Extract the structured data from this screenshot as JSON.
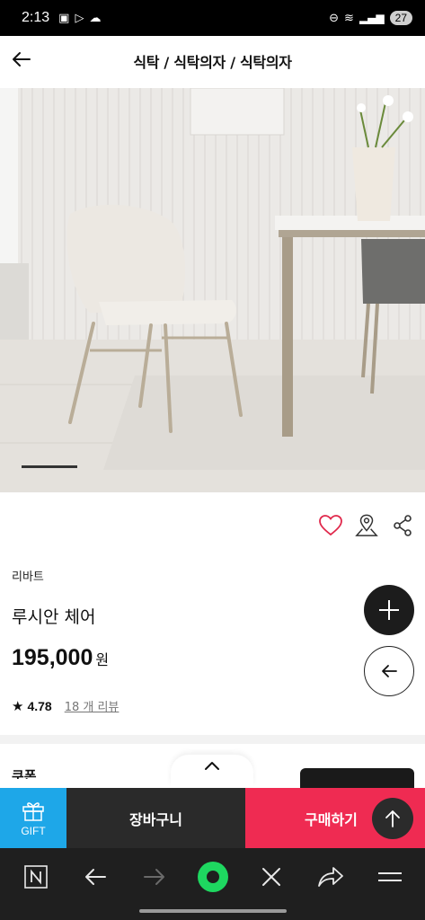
{
  "status_bar": {
    "time": "2:13",
    "battery": "27"
  },
  "header": {
    "title": "식탁 / 식탁의자 / 식탁의자"
  },
  "product": {
    "brand": "리바트",
    "name": "루시안 체어",
    "price": "195,000",
    "price_unit": "원",
    "rating": "4.78",
    "review_count": "18 개 리뷰",
    "image_index": 1
  },
  "coupon": {
    "label": "쿠폰"
  },
  "bottom_bar": {
    "gift_label": "GIFT",
    "cart_label": "장바구니",
    "buy_label": "구매하기"
  },
  "colors": {
    "accent_red": "#ef2b52",
    "gift_blue": "#1ea7e8",
    "dark": "#1c1c1c",
    "heart": "#e0284b",
    "browser_green": "#1ed760"
  },
  "icons": {
    "back": "arrow-left-icon",
    "wishlist": "heart-icon",
    "store": "map-pin-icon",
    "share": "share-icon",
    "plus": "plus-icon",
    "gift": "gift-icon",
    "top": "arrow-up-icon"
  }
}
